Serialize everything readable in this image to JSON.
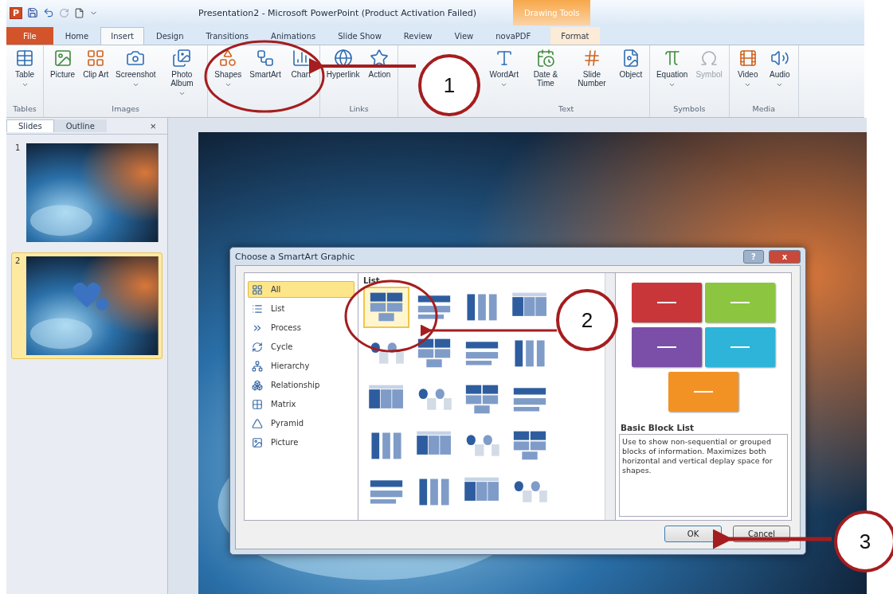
{
  "title_bar": {
    "app_letter": "P",
    "title": "Presentation2  -  Microsoft PowerPoint (Product Activation Failed)",
    "context_label": "Drawing Tools"
  },
  "tabs": [
    {
      "label": "File",
      "kind": "file",
      "selected": false
    },
    {
      "label": "Home",
      "kind": "plain",
      "selected": false
    },
    {
      "label": "Insert",
      "kind": "plain",
      "selected": true
    },
    {
      "label": "Design",
      "kind": "plain",
      "selected": false
    },
    {
      "label": "Transitions",
      "kind": "plain",
      "selected": false
    },
    {
      "label": "Animations",
      "kind": "plain",
      "selected": false
    },
    {
      "label": "Slide Show",
      "kind": "plain",
      "selected": false
    },
    {
      "label": "Review",
      "kind": "plain",
      "selected": false
    },
    {
      "label": "View",
      "kind": "plain",
      "selected": false
    },
    {
      "label": "novaPDF",
      "kind": "plain",
      "selected": false
    },
    {
      "label": "Format",
      "kind": "context",
      "selected": false
    }
  ],
  "ribbon_groups": [
    {
      "label": "Tables",
      "buttons": [
        {
          "label": "Table",
          "dropdown": true,
          "disabled": false
        }
      ]
    },
    {
      "label": "Images",
      "buttons": [
        {
          "label": "Picture",
          "dropdown": false,
          "disabled": false
        },
        {
          "label": "Clip Art",
          "dropdown": false,
          "disabled": false
        },
        {
          "label": "Screenshot",
          "dropdown": true,
          "disabled": false
        },
        {
          "label": "Photo Album",
          "dropdown": true,
          "disabled": false
        }
      ]
    },
    {
      "buttons": [
        {
          "label": "Shapes",
          "dropdown": true,
          "disabled": false
        },
        {
          "label": "SmartArt",
          "dropdown": false,
          "disabled": false
        },
        {
          "label": "Chart",
          "dropdown": false,
          "disabled": false
        }
      ]
    },
    {
      "label": "Links",
      "buttons": [
        {
          "label": "Hyperlink",
          "dropdown": false,
          "disabled": false
        },
        {
          "label": "Action",
          "dropdown": false,
          "disabled": false
        }
      ]
    },
    {
      "label": "Text",
      "buttons": [
        {
          "label": "WordArt",
          "dropdown": true,
          "disabled": false
        },
        {
          "label": "Date & Time",
          "dropdown": false,
          "disabled": false
        },
        {
          "label": "Slide Number",
          "dropdown": false,
          "disabled": false
        },
        {
          "label": "Object",
          "dropdown": false,
          "disabled": false
        }
      ]
    },
    {
      "label": "Symbols",
      "buttons": [
        {
          "label": "Equation",
          "dropdown": true,
          "disabled": false
        },
        {
          "label": "Symbol",
          "dropdown": false,
          "disabled": true
        }
      ]
    },
    {
      "label": "Media",
      "buttons": [
        {
          "label": "Video",
          "dropdown": true,
          "disabled": false
        },
        {
          "label": "Audio",
          "dropdown": true,
          "disabled": false
        }
      ]
    }
  ],
  "panel_tabs": [
    {
      "label": "Slides",
      "selected": true
    },
    {
      "label": "Outline",
      "selected": false
    }
  ],
  "panel_close": "×",
  "slides": [
    {
      "number": "1",
      "selected": false
    },
    {
      "number": "2",
      "selected": true
    }
  ],
  "dialog": {
    "title": "Choose a SmartArt Graphic",
    "help": "?",
    "close": "x",
    "categories": [
      {
        "label": "All",
        "selected": true
      },
      {
        "label": "List",
        "selected": false
      },
      {
        "label": "Process",
        "selected": false
      },
      {
        "label": "Cycle",
        "selected": false
      },
      {
        "label": "Hierarchy",
        "selected": false
      },
      {
        "label": "Relationship",
        "selected": false
      },
      {
        "label": "Matrix",
        "selected": false
      },
      {
        "label": "Pyramid",
        "selected": false
      },
      {
        "label": "Picture",
        "selected": false
      }
    ],
    "gallery_heading": "List",
    "layouts": [
      {
        "selected": true
      },
      {
        "selected": false
      },
      {
        "selected": false
      },
      {
        "selected": false
      },
      {
        "selected": false
      },
      {
        "selected": false
      },
      {
        "selected": false
      },
      {
        "selected": false
      },
      {
        "selected": false
      },
      {
        "selected": false
      },
      {
        "selected": false
      },
      {
        "selected": false
      },
      {
        "selected": false
      },
      {
        "selected": false
      },
      {
        "selected": false
      },
      {
        "selected": false
      },
      {
        "selected": false
      },
      {
        "selected": false
      },
      {
        "selected": false
      },
      {
        "selected": false
      }
    ],
    "preview_blocks": [
      {
        "color": "#c8363a"
      },
      {
        "color": "#8cc53f"
      },
      {
        "color": "#7b4fa8"
      },
      {
        "color": "#2eb4d8"
      },
      {
        "color": "#f39224"
      }
    ],
    "preview_title": "Basic Block List",
    "description": "Use to show non-sequential or grouped blocks of information. Maximizes both horizontal and vertical deplay space for shapes.",
    "buttons": [
      {
        "label": "OK",
        "default": true
      },
      {
        "label": "Cancel",
        "default": false
      }
    ]
  },
  "annotations": [
    {
      "number": "1"
    },
    {
      "number": "2"
    },
    {
      "number": "3"
    }
  ]
}
